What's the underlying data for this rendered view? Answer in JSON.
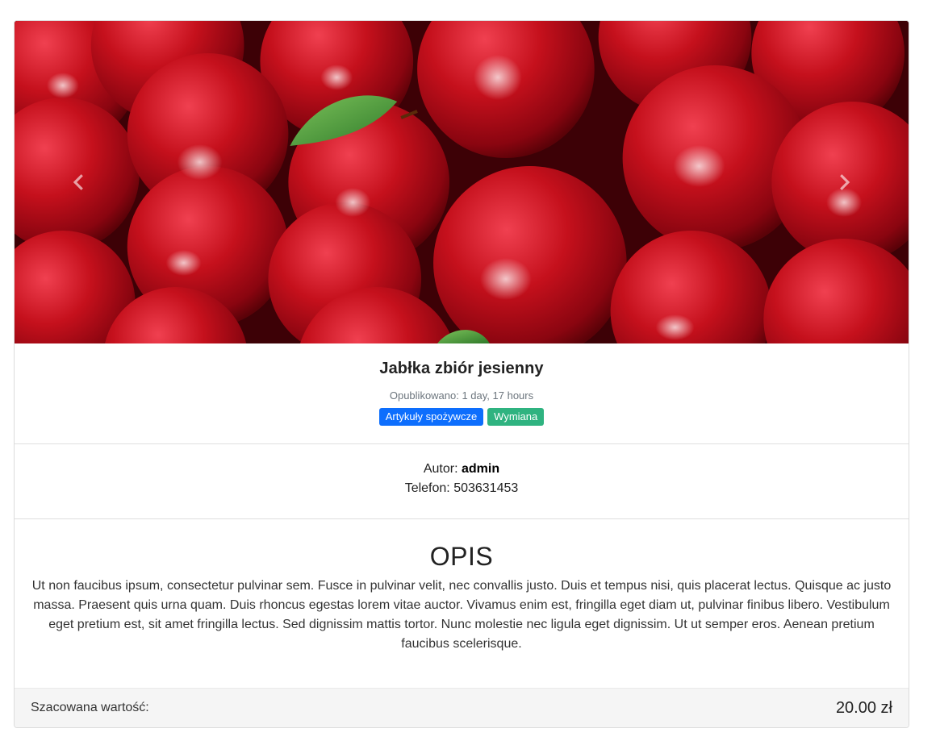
{
  "listing": {
    "title": "Jabłka zbiór jesienny",
    "published": "Opublikowano: 1 day, 17 hours",
    "tags": [
      "Artykuły spożywcze",
      "Wymiana"
    ]
  },
  "author": {
    "prefix": "Autor:",
    "name": "admin",
    "phone": "Telefon: 503631453"
  },
  "description": {
    "heading": "OPIS",
    "text": "Ut non faucibus ipsum, consectetur pulvinar sem. Fusce in pulvinar velit, nec convallis justo. Duis et tempus nisi, quis placerat lectus. Quisque ac justo massa. Praesent quis urna quam. Duis rhoncus egestas lorem vitae auctor. Vivamus enim est, fringilla eget diam ut, pulvinar finibus libero. Vestibulum eget pretium est, sit amet fringilla lectus. Sed dignissim mattis tortor. Nunc molestie nec ligula eget dignissim. Ut ut semper eros. Aenean pretium faucibus scelerisque."
  },
  "footer": {
    "label": "Szacowana wartość:",
    "value": "20.00 zł"
  },
  "carousel": {
    "prev_icon": "chevron-left-icon",
    "next_icon": "chevron-right-icon"
  },
  "colors": {
    "tag_primary": "#0d6efd",
    "tag_success": "#2fb380"
  }
}
